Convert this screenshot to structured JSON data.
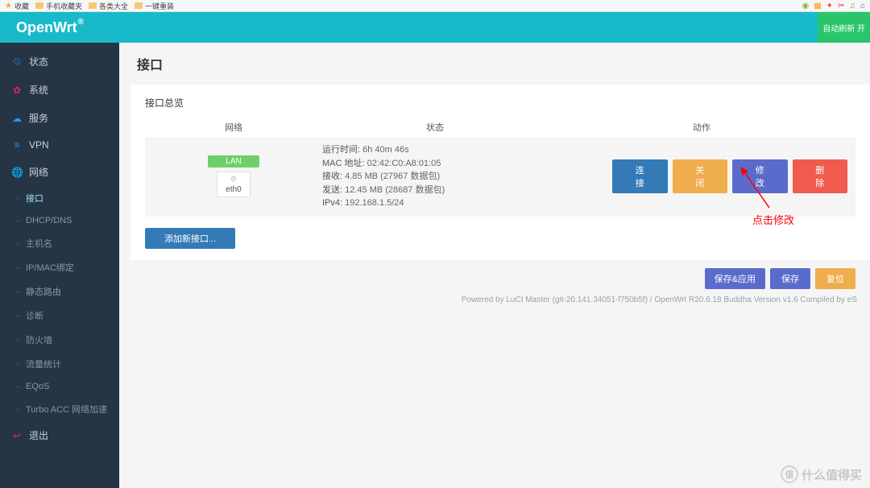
{
  "bookmarks": {
    "b1": "收藏",
    "b2": "手机收藏夹",
    "b3": "各类大全",
    "b4": "一键重装"
  },
  "brand": "OpenWrt",
  "header_action": "自动刷新 开",
  "sidebar": {
    "status": "状态",
    "system": "系统",
    "services": "服务",
    "vpn": "VPN",
    "network": "网络",
    "logout": "退出",
    "sub": {
      "interfaces": "接口",
      "dhcpdns": "DHCP/DNS",
      "hostnames": "主机名",
      "ipmac": "IP/MAC绑定",
      "routes": "静态路由",
      "diag": "诊断",
      "firewall": "防火墙",
      "traffic": "流量统计",
      "eqos": "EQoS",
      "turbo": "Turbo ACC 网络加速"
    }
  },
  "page": {
    "title": "接口",
    "overview": "接口总览"
  },
  "table": {
    "th_net": "网络",
    "th_status": "状态",
    "th_action": "动作"
  },
  "row": {
    "badge": "LAN",
    "ifname": "eth0",
    "uptime_k": "运行时间:",
    "uptime_v": "6h 40m 46s",
    "mac_k": "MAC 地址:",
    "mac_v": "02:42:C0:A8:01:05",
    "rx_k": "接收:",
    "rx_v": "4.85 MB (27967 数据包)",
    "tx_k": "发送:",
    "tx_v": "12.45 MB (28687 数据包)",
    "ipv4_k": "IPv4:",
    "ipv4_v": "192.168.1.5/24"
  },
  "actions": {
    "connect": "连接",
    "close": "关闭",
    "edit": "修改",
    "delete": "删除"
  },
  "add_iface": "添加新接口...",
  "annot": "点击修改",
  "footer_btns": {
    "save_apply": "保存&应用",
    "save": "保存",
    "reset": "复位"
  },
  "footer_text": "Powered by LuCI Master (git-20.141.34051-f750b5f) / OpenWrt R20.6.18 Buddha Version v1.6 Compiled by eS",
  "watermark": "什么值得买",
  "watermark_icon": "值"
}
